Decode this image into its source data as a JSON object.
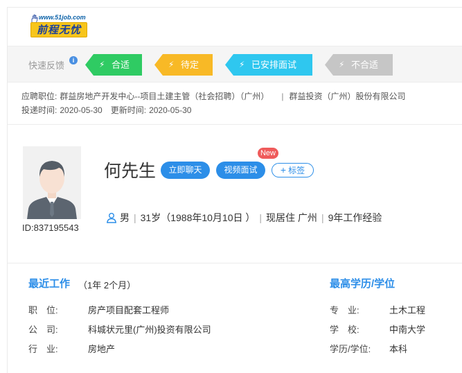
{
  "logo": {
    "url_text": "www.51job.com",
    "brand_text": "前程无忧"
  },
  "feedback": {
    "label": "快速反馈",
    "info_glyph": "i",
    "buttons": [
      {
        "label": "合适",
        "color": "#2fcb63"
      },
      {
        "label": "待定",
        "color": "#f8b926"
      },
      {
        "label": "已安排面试",
        "color": "#2fc7ef"
      },
      {
        "label": "不合适",
        "color": "#c6c6c6"
      }
    ]
  },
  "application": {
    "position_label": "应聘职位:",
    "position_value": "群益房地产开发中心--项目土建主管（社会招聘）（广州）",
    "separator": "|",
    "company": "群益投资（广州）股份有限公司",
    "delivered_label": "投递时间:",
    "delivered_value": "2020-05-30",
    "updated_label": "更新时间:",
    "updated_value": "2020-05-30"
  },
  "profile": {
    "id_text": "ID:837195543",
    "name": "何先生",
    "chat_button": "立即聊天",
    "video_button": "视频面试",
    "new_badge": "New",
    "tag_button": "标签",
    "tag_plus": "+",
    "gender": "男",
    "age": "31岁（1988年10月10日 ）",
    "residence": "现居住 广州",
    "experience": "9年工作经验"
  },
  "recent_work": {
    "title": "最近工作",
    "duration": "（1年 2个月）",
    "rows": [
      {
        "key": "职　位:",
        "value": "房产项目配套工程师"
      },
      {
        "key": "公　司:",
        "value": "科城状元里(广州)投资有限公司"
      },
      {
        "key": "行　业:",
        "value": "房地产"
      }
    ]
  },
  "education": {
    "title": "最高学历/学位",
    "rows": [
      {
        "key": "专　业:",
        "value": "土木工程"
      },
      {
        "key": "学　校:",
        "value": "中南大学"
      },
      {
        "key": "学历/学位:",
        "value": "本科"
      }
    ]
  }
}
